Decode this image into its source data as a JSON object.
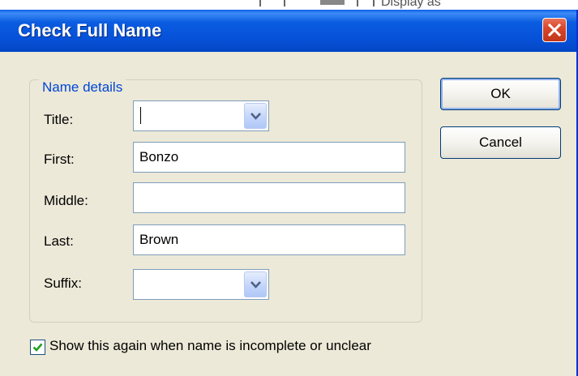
{
  "background": {
    "partial_text": "Display as"
  },
  "dialog": {
    "title": "Check Full Name",
    "group_label": "Name details",
    "fields": {
      "title": {
        "label": "Title:",
        "value": ""
      },
      "first": {
        "label": "First:",
        "value": "Bonzo"
      },
      "middle": {
        "label": "Middle:",
        "value": ""
      },
      "last": {
        "label": "Last:",
        "value": "Brown"
      },
      "suffix": {
        "label": "Suffix:",
        "value": ""
      }
    },
    "buttons": {
      "ok": "OK",
      "cancel": "Cancel"
    },
    "checkbox": {
      "label": "Show this again when name is incomplete or unclear",
      "checked": true
    }
  },
  "colors": {
    "titlebar": "#0651d8",
    "dialog_bg": "#ece9d8",
    "group_label": "#0046d5",
    "close_button": "#d9472b"
  },
  "icons": [
    "close-icon",
    "dropdown-arrow-icon",
    "checkmark-icon"
  ]
}
